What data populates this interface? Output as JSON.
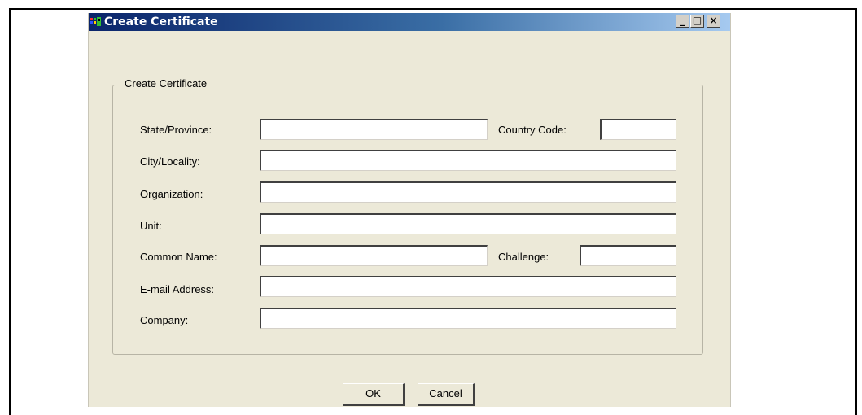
{
  "window": {
    "title": "Create Certificate",
    "controls": {
      "minimize": "_",
      "maximize": "□",
      "close": "×"
    }
  },
  "group": {
    "legend": "Create Certificate",
    "fields": {
      "state": {
        "label": "State/Province:",
        "value": ""
      },
      "country": {
        "label": "Country Code:",
        "value": ""
      },
      "city": {
        "label": "City/Locality:",
        "value": ""
      },
      "organization": {
        "label": "Organization:",
        "value": ""
      },
      "unit": {
        "label": "Unit:",
        "value": ""
      },
      "common_name": {
        "label": "Common Name:",
        "value": ""
      },
      "challenge": {
        "label": "Challenge:",
        "value": ""
      },
      "email": {
        "label": "E-mail Address:",
        "value": ""
      },
      "company": {
        "label": "Company:",
        "value": ""
      }
    }
  },
  "buttons": {
    "ok": "OK",
    "cancel": "Cancel"
  },
  "colors": {
    "titlebar_start": "#0a246a",
    "titlebar_end": "#a6caf0",
    "dialog_bg": "#ece9d8"
  },
  "icons": {
    "app": "app-icon"
  }
}
